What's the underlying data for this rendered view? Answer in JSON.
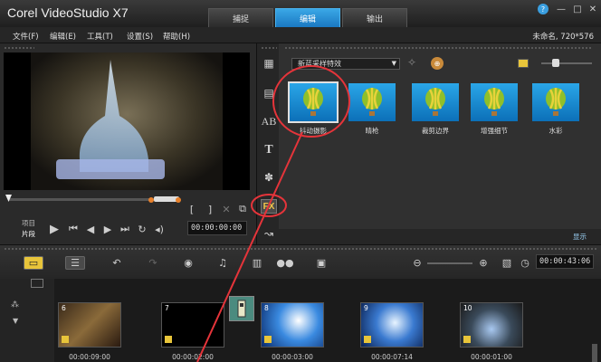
{
  "app": {
    "title": "Corel VideoStudio X7"
  },
  "tabs": [
    {
      "label": "捕捉",
      "active": false
    },
    {
      "label": "编辑",
      "active": true
    },
    {
      "label": "输出",
      "active": false
    }
  ],
  "window_controls": {
    "help": "?",
    "minimize": "—",
    "maximize": "□",
    "close": "✕"
  },
  "menu": [
    "文件(F)",
    "编辑(E)",
    "工具(T)",
    "设置(S)",
    "帮助(H)"
  ],
  "project_info": "未命名, 720*576",
  "player": {
    "mode_project": "项目",
    "mode_clip": "片段",
    "timecode": "00:00:00:00",
    "mark_in": "[",
    "mark_out": "]"
  },
  "library": {
    "category": "新蓝采样特效",
    "filters": [
      {
        "label": "抖动摄影",
        "selected": true
      },
      {
        "label": "晴枪",
        "selected": false
      },
      {
        "label": "裁剪边界",
        "selected": false
      },
      {
        "label": "增强细节",
        "selected": false
      },
      {
        "label": "水彩",
        "selected": false
      }
    ],
    "footer_label": "显示"
  },
  "timeline": {
    "timecode": "00:00:43:06",
    "clips": [
      {
        "number": "6",
        "duration": "00:00:09:00"
      },
      {
        "number": "7",
        "duration": "00:00:02:00"
      },
      {
        "number": "8",
        "duration": "00:00:03:00"
      },
      {
        "number": "9",
        "duration": "00:00:07:14"
      },
      {
        "number": "10",
        "duration": "00:00:01:00"
      }
    ]
  },
  "colors": {
    "accent": "#2a9de0",
    "annotation": "#e5343a",
    "title_bar": "#2a2a2a"
  }
}
